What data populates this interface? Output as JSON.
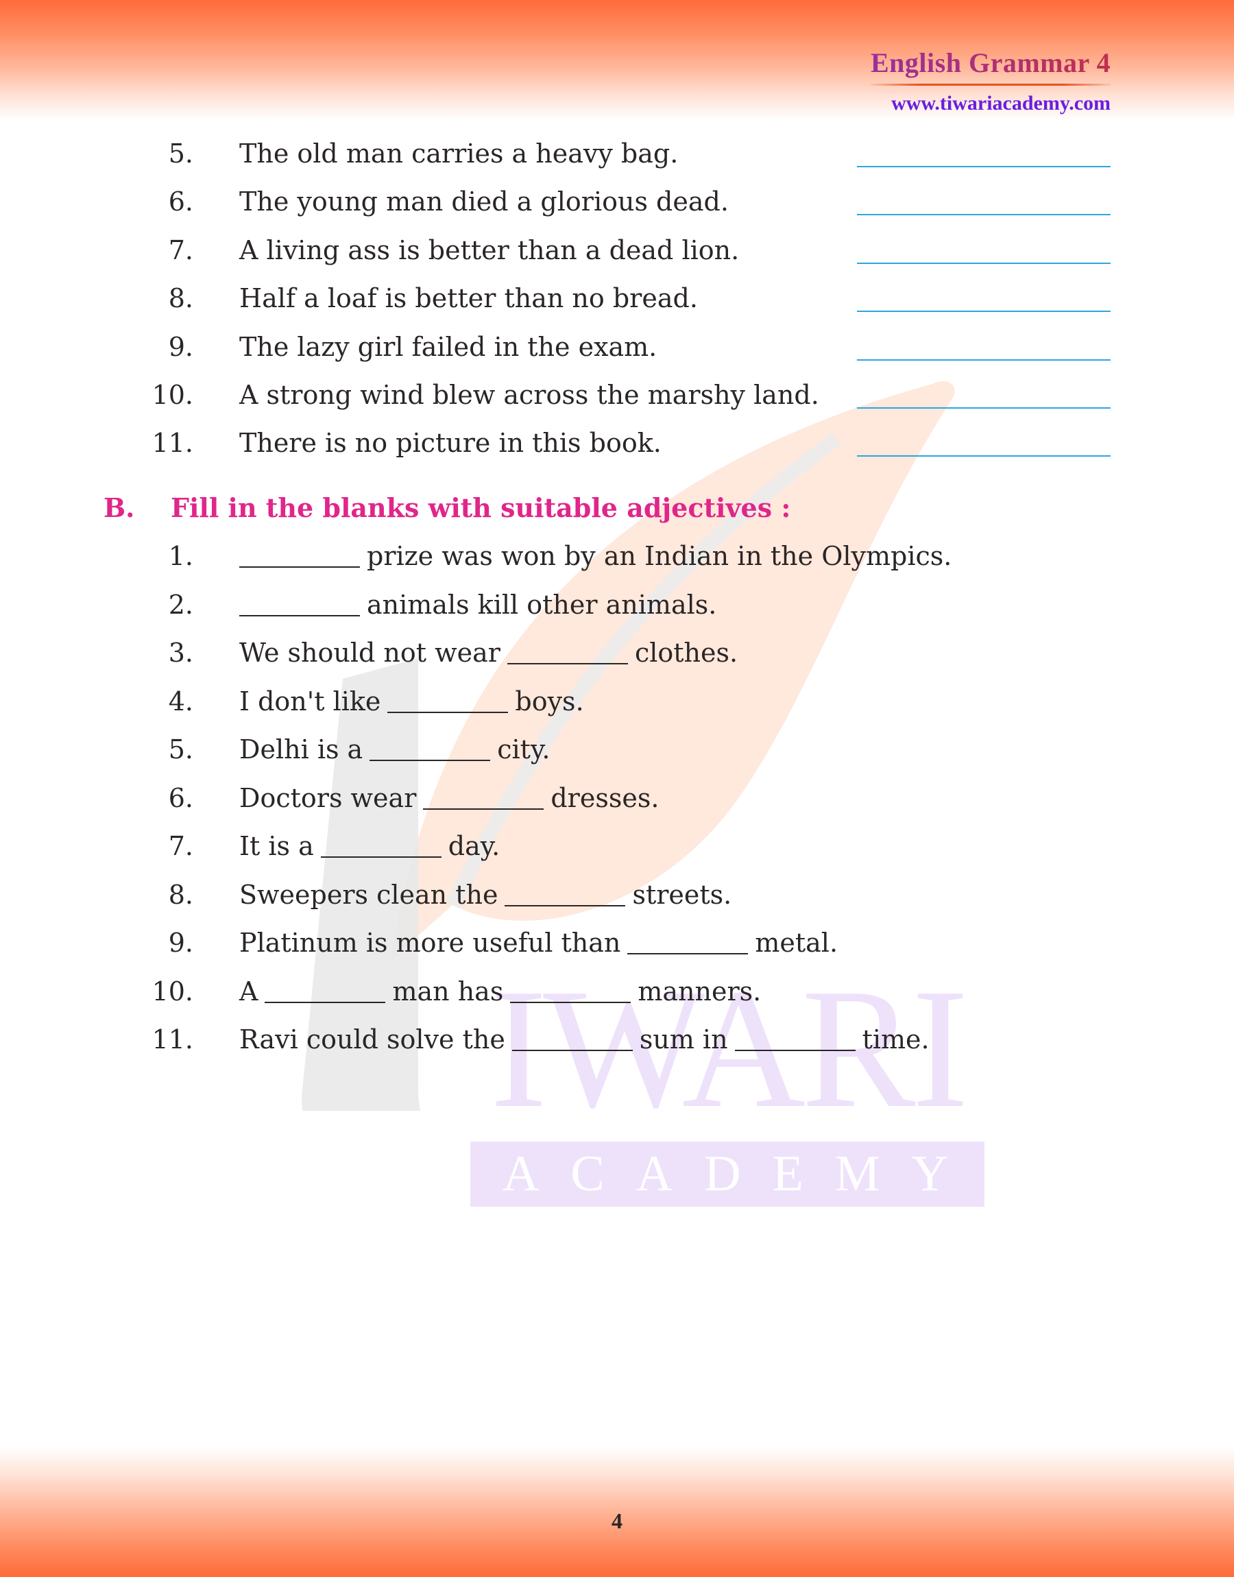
{
  "header": {
    "title": "English Grammar 4",
    "url": "www.tiwariacademy.com"
  },
  "colors": {
    "band": "#ff6b3a",
    "title_gradient_start": "#9b2f9d",
    "title_gradient_end": "#c0304e",
    "url": "#6a1de0",
    "section_heading": "#e0268a",
    "answer_line": "#2aa8e0",
    "body_text": "#2b2626"
  },
  "section_a_items": [
    {
      "num": "5.",
      "text": "The old man carries a heavy bag."
    },
    {
      "num": "6.",
      "text": "The young man died a glorious dead."
    },
    {
      "num": "7.",
      "text": "A living ass is better than a dead lion."
    },
    {
      "num": "8.",
      "text": "Half a loaf is better than no bread."
    },
    {
      "num": "9.",
      "text": "The lazy girl failed in the exam."
    },
    {
      "num": "10.",
      "text": "A strong wind blew across the marshy land."
    },
    {
      "num": "11.",
      "text": "There is no picture in this book."
    }
  ],
  "section_b": {
    "letter": "B.",
    "title": "Fill in the blanks with suitable adjectives :",
    "items": [
      {
        "num": "1.",
        "parts": [
          "",
          "prize was won by an Indian in the Olympics."
        ]
      },
      {
        "num": "2.",
        "parts": [
          "",
          "animals kill other animals."
        ]
      },
      {
        "num": "3.",
        "parts": [
          "We should not wear",
          "clothes."
        ]
      },
      {
        "num": "4.",
        "parts": [
          "I don't like",
          "boys."
        ]
      },
      {
        "num": "5.",
        "parts": [
          "Delhi is a",
          "city."
        ]
      },
      {
        "num": "6.",
        "parts": [
          "Doctors wear",
          "dresses."
        ]
      },
      {
        "num": "7.",
        "parts": [
          "It is a",
          "day."
        ]
      },
      {
        "num": "8.",
        "parts": [
          "Sweepers clean the",
          "streets."
        ]
      },
      {
        "num": "9.",
        "parts": [
          "Platinum is more useful than",
          "metal."
        ]
      },
      {
        "num": "10.",
        "parts": [
          "A",
          "man has",
          "manners."
        ]
      },
      {
        "num": "11.",
        "parts": [
          "Ravi could solve the",
          "sum in",
          "time."
        ]
      }
    ]
  },
  "watermark": {
    "word1": "IWARI",
    "word2": "ACADEMY"
  },
  "footer": {
    "page_number": "4"
  }
}
